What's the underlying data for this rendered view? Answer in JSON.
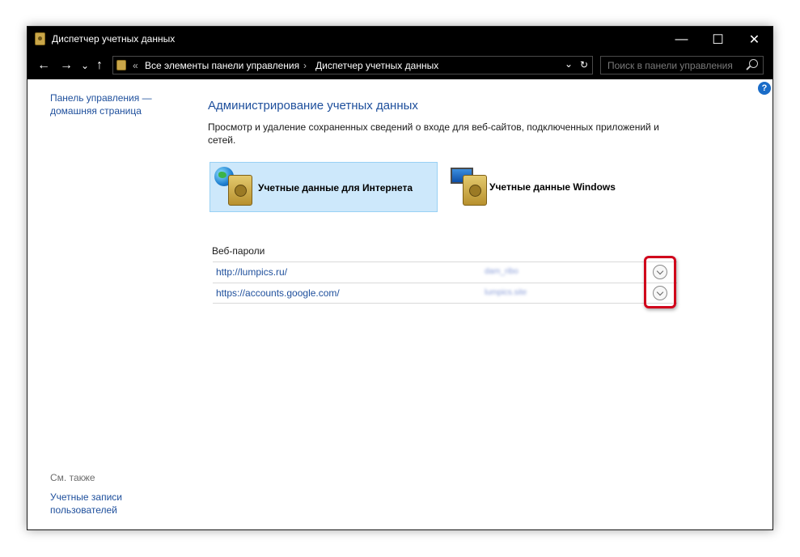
{
  "window": {
    "title": "Диспетчер учетных данных",
    "controls": {
      "minimize": "—",
      "maximize": "☐",
      "close": "✕"
    }
  },
  "nav": {
    "back": "←",
    "forward": "→",
    "recent": "⌄",
    "up": "↑"
  },
  "address": {
    "prefix": "«",
    "crumb1": "Все элементы панели управления",
    "separator": "›",
    "crumb2": "Диспетчер учетных данных",
    "dropdown": "⌄",
    "refresh": "↻"
  },
  "search": {
    "placeholder": "Поиск в панели управления"
  },
  "help": "?",
  "sidebar": {
    "home_link": "Панель управления — домашняя страница",
    "home_line1": "Панель управления —",
    "home_line2": "домашняя страница",
    "see_also": "См. также",
    "user_accounts_line1": "Учетные записи",
    "user_accounts_line2": "пользователей"
  },
  "main": {
    "heading": "Администрирование учетных данных",
    "description": "Просмотр и удаление сохраненных сведений о входе для веб-сайтов, подключенных приложений и сетей.",
    "tiles": [
      {
        "label": "Учетные данные для Интернета",
        "selected": true
      },
      {
        "label": "Учетные данные Windows",
        "selected": false
      }
    ],
    "section_title": "Веб-пароли",
    "passwords": [
      {
        "url": "http://lumpics.ru/",
        "user": "dam_ribo"
      },
      {
        "url": "https://accounts.google.com/",
        "user": "lumpics.site"
      }
    ]
  },
  "colors": {
    "accent": "#1e4f9c",
    "selection": "#cde8fb",
    "highlight": "#d0021b"
  }
}
